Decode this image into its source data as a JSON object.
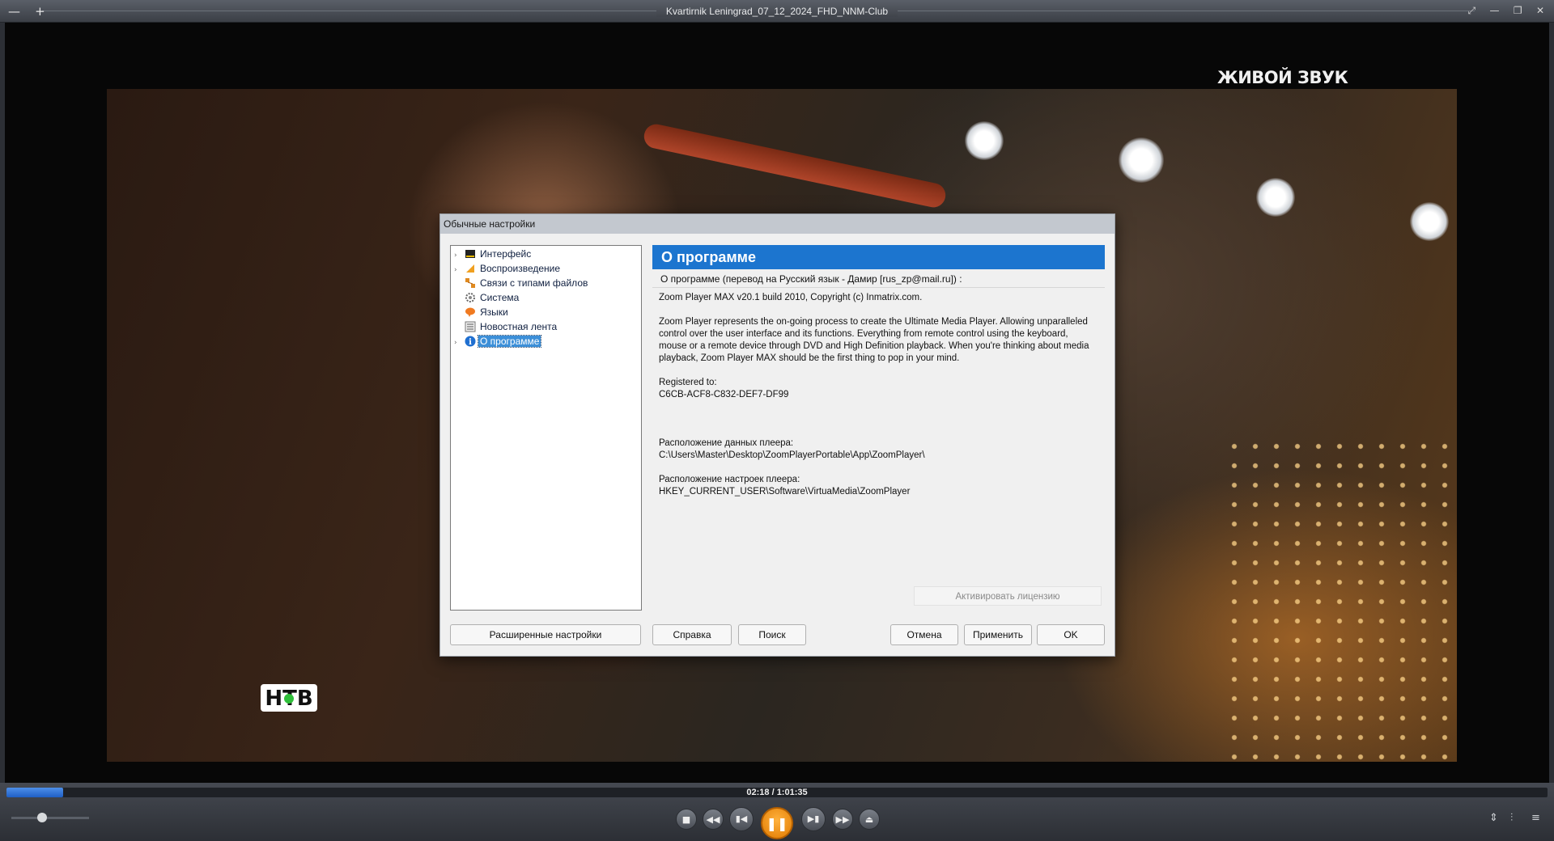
{
  "window": {
    "title": "Kvartirnik Leningrad_07_12_2024_FHD_NNM-Club",
    "left_icons": [
      "—",
      "+"
    ],
    "right_icons": [
      "⤢",
      "—",
      "❐",
      "✕"
    ]
  },
  "video": {
    "watermark": "ЖИВОЙ ЗВУК",
    "channel_logo": "НТВ"
  },
  "dialog": {
    "title": "Обычные настройки",
    "tree": [
      {
        "label": "Интерфейс",
        "icon": "interface-icon",
        "expandable": true
      },
      {
        "label": "Воспроизведение",
        "icon": "playback-icon",
        "expandable": true
      },
      {
        "label": "Связи с типами файлов",
        "icon": "file-assoc-icon",
        "expandable": false
      },
      {
        "label": "Система",
        "icon": "gear-icon",
        "expandable": false
      },
      {
        "label": "Языки",
        "icon": "language-icon",
        "expandable": false
      },
      {
        "label": "Новостная лента",
        "icon": "news-icon",
        "expandable": false
      },
      {
        "label": "О программе",
        "icon": "info-icon",
        "expandable": true,
        "selected": true
      }
    ],
    "header": "О программе",
    "subhead": "О программе (перевод на Русский язык - Дамир [rus_zp@mail.ru]) :",
    "info": {
      "version": "Zoom Player MAX v20.1 build 2010, Copyright (c) Inmatrix.com.",
      "description": "Zoom Player represents the on-going process to create the Ultimate Media Player. Allowing unparalleled control over the user interface and its functions. Everything from remote control using the keyboard, mouse or a remote device through DVD and High Definition playback. When you're thinking about media playback, Zoom Player MAX should be the first thing to pop in your mind.",
      "registered_label": "Registered to:",
      "registered_value": "C6CB-ACF8-C832-DEF7-DF99",
      "data_location_label": "Расположение данных плеера:",
      "data_location_value": "C:\\Users\\Master\\Desktop\\ZoomPlayerPortable\\App\\ZoomPlayer\\",
      "settings_location_label": "Расположение настроек плеера:",
      "settings_location_value": "HKEY_CURRENT_USER\\Software\\VirtuaMedia\\ZoomPlayer"
    },
    "activate_label": "Активировать лицензию",
    "buttons": {
      "advanced": "Расширенные настройки",
      "help": "Справка",
      "search": "Поиск",
      "cancel": "Отмена",
      "apply": "Применить",
      "ok": "OK"
    }
  },
  "player": {
    "time": "02:18 / 1:01:35",
    "progress_fraction": 0.037,
    "volume_fraction": 0.4,
    "accent_color": "#f09010",
    "controls": [
      "stop-icon",
      "rewind-icon",
      "previous-icon",
      "pause-icon",
      "next-icon",
      "fast-forward-icon",
      "open-icon"
    ],
    "right_icons": [
      "⇕",
      "⫶",
      "≡"
    ]
  }
}
